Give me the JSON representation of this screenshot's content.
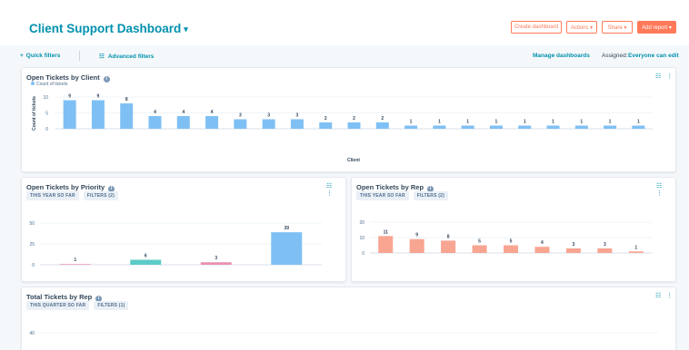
{
  "header": {
    "title": "Client Support Dashboard",
    "caret": "▾",
    "buttons": {
      "create": "Create dashboard",
      "actions": "Actions ▾",
      "share": "Share ▾",
      "add_report": "Add report ▾"
    }
  },
  "filters": {
    "quick": "Quick filters",
    "quick_icon": "plus-icon",
    "advanced": "Advanced filters",
    "advanced_icon": "sliders-icon",
    "manage": "Manage dashboards",
    "assigned_label": "Assigned:",
    "assigned_value": "Everyone can edit"
  },
  "cards": {
    "client": {
      "title": "Open Tickets by Client",
      "legend": "Count of tickets",
      "tools": "☷ ⋮",
      "chart_data": {
        "type": "bar",
        "title": "Open Tickets by Client",
        "xlabel": "Client",
        "ylabel": "Count of tickets",
        "ylim": [
          0,
          10
        ],
        "yticks": [
          0,
          5,
          10
        ],
        "values": [
          9,
          9,
          8,
          4,
          4,
          4,
          3,
          3,
          3,
          2,
          2,
          2,
          1,
          1,
          1,
          1,
          1,
          1,
          1,
          1,
          1
        ],
        "color": "#7fc0f4"
      }
    },
    "priority": {
      "title": "Open Tickets by Priority",
      "pills": [
        "THIS YEAR SO FAR",
        "FILTERS (2)"
      ],
      "tools": "☷ ⋮",
      "chart_data": {
        "type": "bar",
        "title": "Open Tickets by Priority",
        "ylim": [
          0,
          50
        ],
        "yticks": [
          0,
          25,
          50
        ],
        "values": [
          1,
          6,
          3,
          39
        ],
        "colors": [
          "#f2a7c3",
          "#5ccbc8",
          "#ea90b1",
          "#7fc0f4"
        ]
      }
    },
    "rep": {
      "title": "Open Tickets by Rep",
      "pills": [
        "THIS YEAR SO FAR",
        "FILTERS (2)"
      ],
      "tools": "☷ ⋮",
      "chart_data": {
        "type": "bar",
        "title": "Open Tickets by Rep",
        "ylim": [
          0,
          20
        ],
        "yticks": [
          0,
          10,
          20
        ],
        "values": [
          11,
          9,
          8,
          5,
          5,
          4,
          3,
          3,
          1
        ],
        "color": "#f8a592"
      }
    },
    "total": {
      "title": "Total Tickets by Rep",
      "pills": [
        "THIS QUARTER SO FAR",
        "FILTERS (1)"
      ],
      "tools": "☷ ⋮",
      "chart_data": {
        "type": "bar",
        "title": "Total Tickets by Rep",
        "yticks": [
          40
        ]
      }
    }
  }
}
